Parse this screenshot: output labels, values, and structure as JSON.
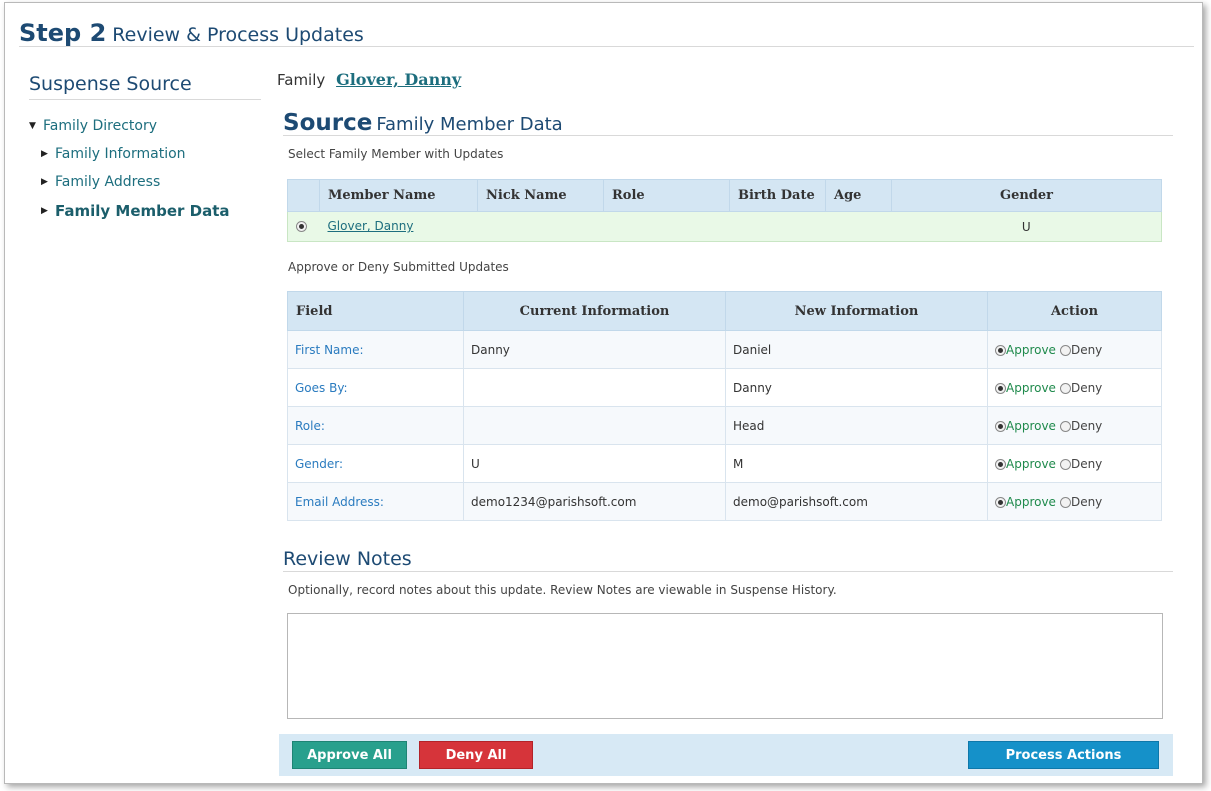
{
  "header": {
    "step_label": "Step 2",
    "title": "Review & Process Updates"
  },
  "sidebar": {
    "title": "Suspense Source",
    "root": "Family Directory",
    "items": [
      {
        "label": "Family Information",
        "active": false
      },
      {
        "label": "Family Address",
        "active": false
      },
      {
        "label": "Family Member Data",
        "active": true
      }
    ]
  },
  "family": {
    "label": "Family",
    "name": "Glover, Danny"
  },
  "source": {
    "title_bold": "Source",
    "title_rest": "Family Member Data",
    "select_hint": "Select Family Member with Updates"
  },
  "members_table": {
    "headers": [
      "Member Name",
      "Nick Name",
      "Role",
      "Birth Date",
      "Age",
      "Gender"
    ],
    "rows": [
      {
        "selected": true,
        "member_name": "Glover, Danny",
        "nick_name": "",
        "role": "",
        "birth_date": "",
        "age": "",
        "gender": "U"
      }
    ]
  },
  "updates": {
    "hint": "Approve or Deny Submitted Updates",
    "headers": [
      "Field",
      "Current Information",
      "New Information",
      "Action"
    ],
    "approve_label": "Approve",
    "deny_label": "Deny",
    "rows": [
      {
        "field": "First Name:",
        "current": "Danny",
        "new": "Daniel",
        "action": "Approve"
      },
      {
        "field": "Goes By:",
        "current": "",
        "new": "Danny",
        "action": "Approve"
      },
      {
        "field": "Role:",
        "current": "",
        "new": "Head",
        "action": "Approve"
      },
      {
        "field": "Gender:",
        "current": "U",
        "new": "M",
        "action": "Approve"
      },
      {
        "field": "Email Address:",
        "current": "demo1234@parishsoft.com",
        "new": "demo@parishsoft.com",
        "action": "Approve"
      }
    ]
  },
  "notes": {
    "title": "Review Notes",
    "hint": "Optionally, record notes about this update. Review Notes are viewable in Suspense History.",
    "value": ""
  },
  "buttons": {
    "approve_all": "Approve All",
    "deny_all": "Deny All",
    "process": "Process Actions"
  },
  "colors": {
    "approve_all": "#28a08d",
    "deny_all": "#d6343a",
    "process": "#1591c9",
    "header_bg": "#d4e6f3",
    "selected_row": "#e9f9e7"
  }
}
